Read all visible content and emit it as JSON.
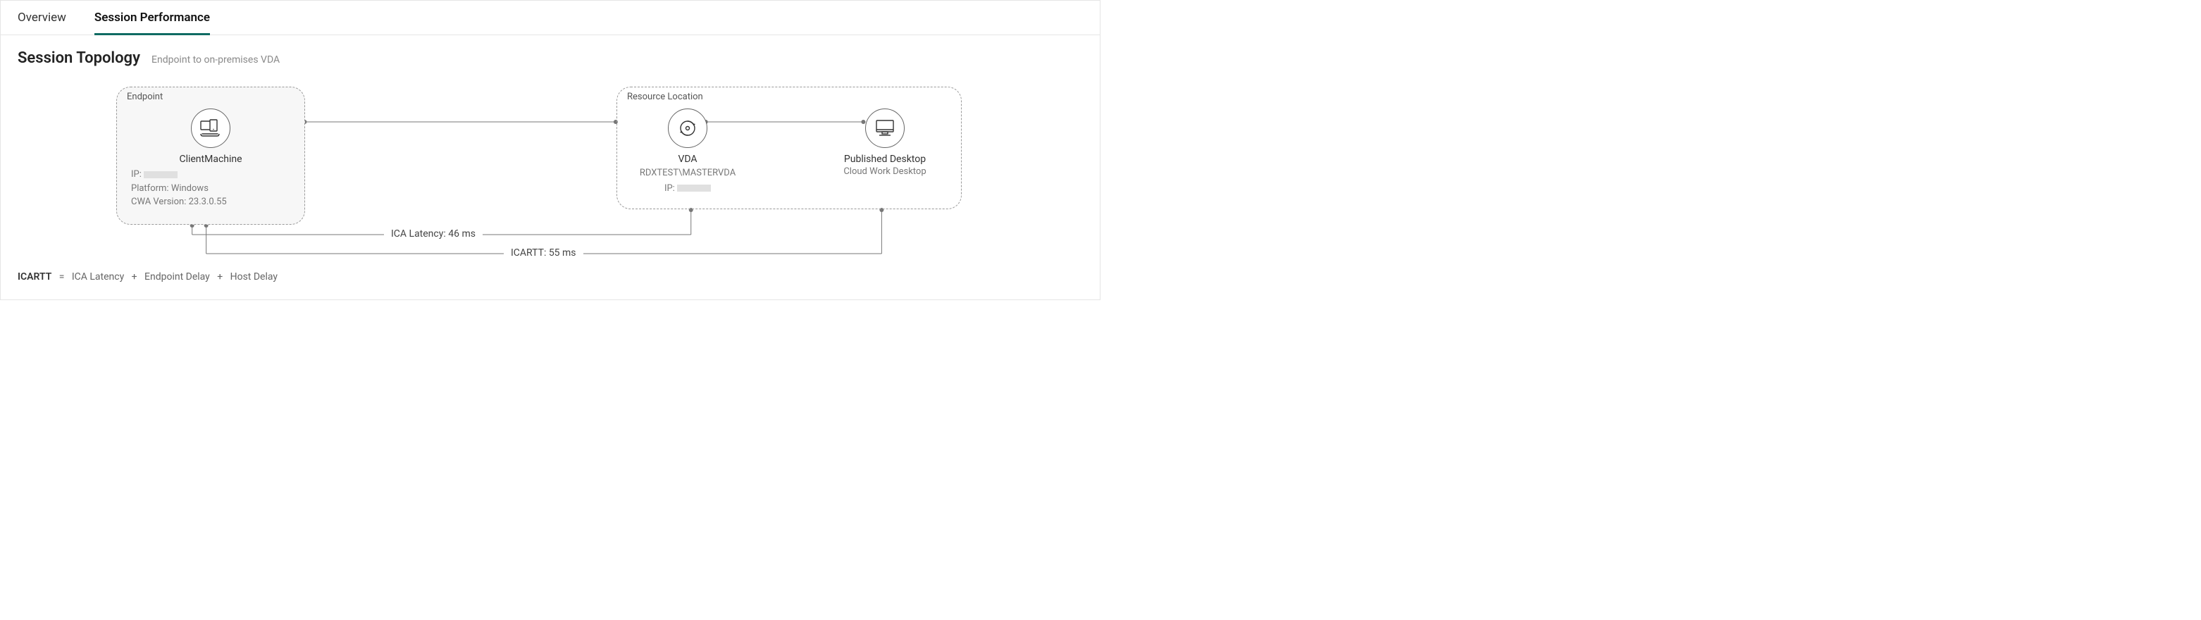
{
  "tabs": {
    "overview": "Overview",
    "session_performance": "Session Performance"
  },
  "section": {
    "title": "Session Topology",
    "subtitle": "Endpoint to on-premises VDA"
  },
  "endpoint": {
    "box_label": "Endpoint",
    "name": "ClientMachine",
    "ip_label": "IP:",
    "platform_label": "Platform:",
    "platform_value": "Windows",
    "cwa_label": "CWA Version:",
    "cwa_value": "23.3.0.55"
  },
  "resource": {
    "box_label": "Resource Location",
    "vda_label": "VDA",
    "vda_hostname": "RDXTEST\\MASTERVDA",
    "vda_ip_label": "IP:",
    "desktop_label": "Published Desktop",
    "desktop_name": "Cloud Work Desktop"
  },
  "metrics": {
    "ica_latency": "ICA Latency: 46 ms",
    "icartt": "ICARTT: 55 ms"
  },
  "formula": {
    "lhs": "ICARTT",
    "eq": "=",
    "p1": "ICA Latency",
    "plus": "+",
    "p2": "Endpoint Delay",
    "p3": "Host Delay"
  }
}
